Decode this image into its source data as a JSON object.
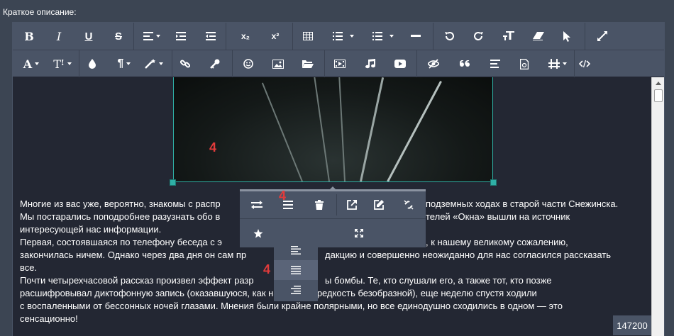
{
  "field_label": "Краткое описание:",
  "image_badge": "4",
  "popover_badge": "4",
  "dropdown_badge": "4",
  "char_counter": "147200",
  "content_lines": [
    "Многие из вас уже, вероятно, знакомы с распр",
    "Мы постарались поподробнее разузнать обо в",
    "интересующей нас информации.",
    "Первая, состоявшаяся по телефону беседа с э",
    "закончилась ничем. Однако через два дня он сам пр",
    "все.",
    "Почти четырехчасовой рассказ произвел эффект разр",
    "расшифровывал диктофонную запись (оказавшуюся, как на грех, на редкость безобразной), еще неделю спустя ходили",
    "с воспаленными от бессонных ночей глазами. Мнения были крайне полярными, но все единодушно сходились в одном — это",
    "сенсационно!"
  ],
  "content_lines_right": [
    "подземных ходах в старой части Снежинска.",
    "телей «Окна» вышли на источник",
    "",
    ", к нашему великому сожалению,",
    "дакцию и совершенно неожиданно для нас согласился рассказать",
    "",
    "ы бомбы. Те, кто слушали его, а также тот, кто позже"
  ],
  "toolbar": {
    "row1": [
      "bold-icon",
      "italic-icon",
      "underline-icon",
      "strikethrough-icon",
      "align-icon",
      "indent-icon",
      "outdent-icon",
      "subscript-icon",
      "superscript-icon",
      "table-icon",
      "ordered-list-icon",
      "unordered-list-icon",
      "horizontal-rule-icon",
      "undo-icon",
      "redo-icon",
      "clear-format-icon",
      "eraser-icon",
      "select-icon",
      "fullscreen-icon"
    ],
    "row2": [
      "text-color-icon",
      "font-size-icon",
      "fill-color-icon",
      "paragraph-icon",
      "magic-icon",
      "link-icon",
      "key-icon",
      "emoticon-icon",
      "image-icon",
      "folder-icon",
      "video-file-icon",
      "music-icon",
      "youtube-icon",
      "hidden-icon",
      "quote-icon",
      "text-block-icon",
      "file-icon",
      "layout-icon",
      "code-icon"
    ],
    "labels": {
      "bold": "B",
      "italic": "I",
      "underline": "U",
      "strikethrough": "S",
      "subscript": "x₂",
      "superscript": "x²",
      "font_size": "T",
      "text_color": "A"
    }
  },
  "colors": {
    "toolbar_bg": "#4a5466",
    "content_bg": "#232733",
    "page_bg": "#3c4553",
    "accent": "#2fb0a6",
    "badge_red": "#e23b3b"
  }
}
